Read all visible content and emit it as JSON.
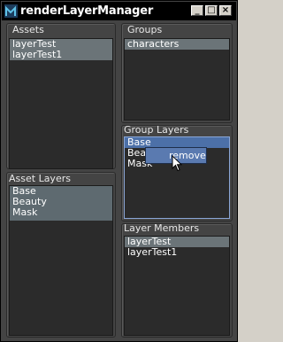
{
  "window": {
    "title": "renderLayerManager",
    "buttons": [
      "_",
      "□",
      "×"
    ]
  },
  "assets": {
    "label": "Assets",
    "items": [
      {
        "text": "layerTest",
        "selected": true
      },
      {
        "text": "layerTest1",
        "selected": true
      }
    ]
  },
  "groups": {
    "label": "Groups",
    "items": [
      {
        "text": "characters",
        "selected": true
      }
    ]
  },
  "group_layers": {
    "label": "Group Layers",
    "items": [
      {
        "text": "Base"
      },
      {
        "text": "Beauty"
      },
      {
        "text": "Mask"
      }
    ]
  },
  "asset_layers": {
    "label": "Asset Layers",
    "items": [
      {
        "text": "Base"
      },
      {
        "text": "Beauty"
      },
      {
        "text": "Mask"
      }
    ]
  },
  "layer_members": {
    "label": "Layer Members",
    "items": [
      {
        "text": "layerTest"
      },
      {
        "text": "layerTest1"
      }
    ]
  },
  "context_menu": {
    "items": [
      "remove"
    ]
  },
  "icons": {
    "app": "maya-app-icon",
    "cursor": "arrow-cursor-icon"
  },
  "colors": {
    "panel": "#444444",
    "list_bg": "#2b2b2b",
    "selection": "#5e6a70",
    "highlight": "#4c70a8"
  }
}
